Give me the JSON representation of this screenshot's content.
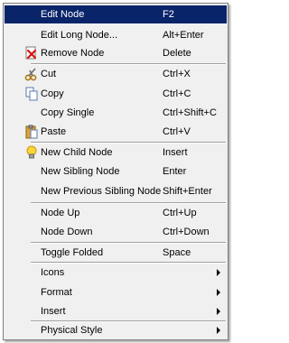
{
  "menu": {
    "edit_node": {
      "label": "Edit Node",
      "shortcut": "F2"
    },
    "edit_long_node": {
      "label": "Edit Long Node...",
      "shortcut": "Alt+Enter"
    },
    "remove_node": {
      "label": "Remove Node",
      "shortcut": "Delete"
    },
    "cut": {
      "label": "Cut",
      "shortcut": "Ctrl+X"
    },
    "copy": {
      "label": "Copy",
      "shortcut": "Ctrl+C"
    },
    "copy_single": {
      "label": "Copy Single",
      "shortcut": "Ctrl+Shift+C"
    },
    "paste": {
      "label": "Paste",
      "shortcut": "Ctrl+V"
    },
    "new_child_node": {
      "label": "New Child Node",
      "shortcut": "Insert"
    },
    "new_sibling_node": {
      "label": "New Sibling Node",
      "shortcut": "Enter"
    },
    "new_prev_sibling_node": {
      "label": "New Previous Sibling Node",
      "shortcut": "Shift+Enter"
    },
    "node_up": {
      "label": "Node Up",
      "shortcut": "Ctrl+Up"
    },
    "node_down": {
      "label": "Node Down",
      "shortcut": "Ctrl+Down"
    },
    "toggle_folded": {
      "label": "Toggle Folded",
      "shortcut": "Space"
    },
    "icons": {
      "label": "Icons"
    },
    "format": {
      "label": "Format"
    },
    "insert": {
      "label": "Insert"
    },
    "physical_style": {
      "label": "Physical Style"
    }
  },
  "icons": {
    "remove_node": "remove-x-icon",
    "cut": "scissors-icon",
    "copy": "copy-icon",
    "paste": "paste-clipboard-icon",
    "new_child_node": "lightbulb-icon"
  },
  "colors": {
    "selected_bg": "#0a246a",
    "menu_bg": "#f0f0f0"
  }
}
